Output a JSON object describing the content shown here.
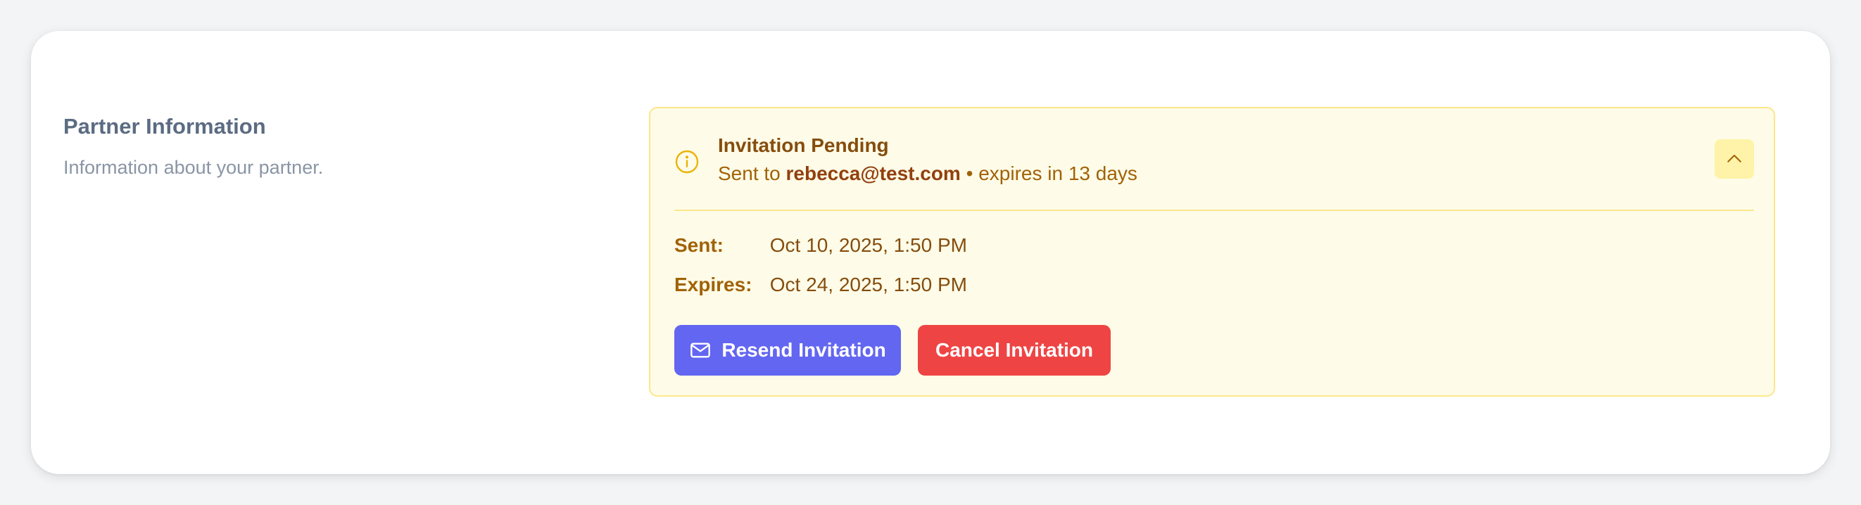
{
  "section": {
    "title": "Partner Information",
    "description": "Information about your partner."
  },
  "invitation": {
    "title": "Invitation Pending",
    "sent_to_prefix": "Sent to",
    "email": "rebecca@test.com",
    "separator": "•",
    "expires_text": "expires in 13 days",
    "details": [
      {
        "label": "Sent:",
        "value": "Oct 10, 2025, 1:50 PM"
      },
      {
        "label": "Expires:",
        "value": "Oct 24, 2025, 1:50 PM"
      }
    ],
    "resend_label": "Resend Invitation",
    "cancel_label": "Cancel Invitation"
  },
  "icons": {
    "status": "info-icon",
    "collapse": "chevron-up-icon",
    "resend": "mail-icon"
  },
  "colors": {
    "banner_bg": "#fefce8",
    "banner_border": "#fde68a",
    "resend_button": "#6366f1",
    "cancel_button": "#ef4444"
  }
}
